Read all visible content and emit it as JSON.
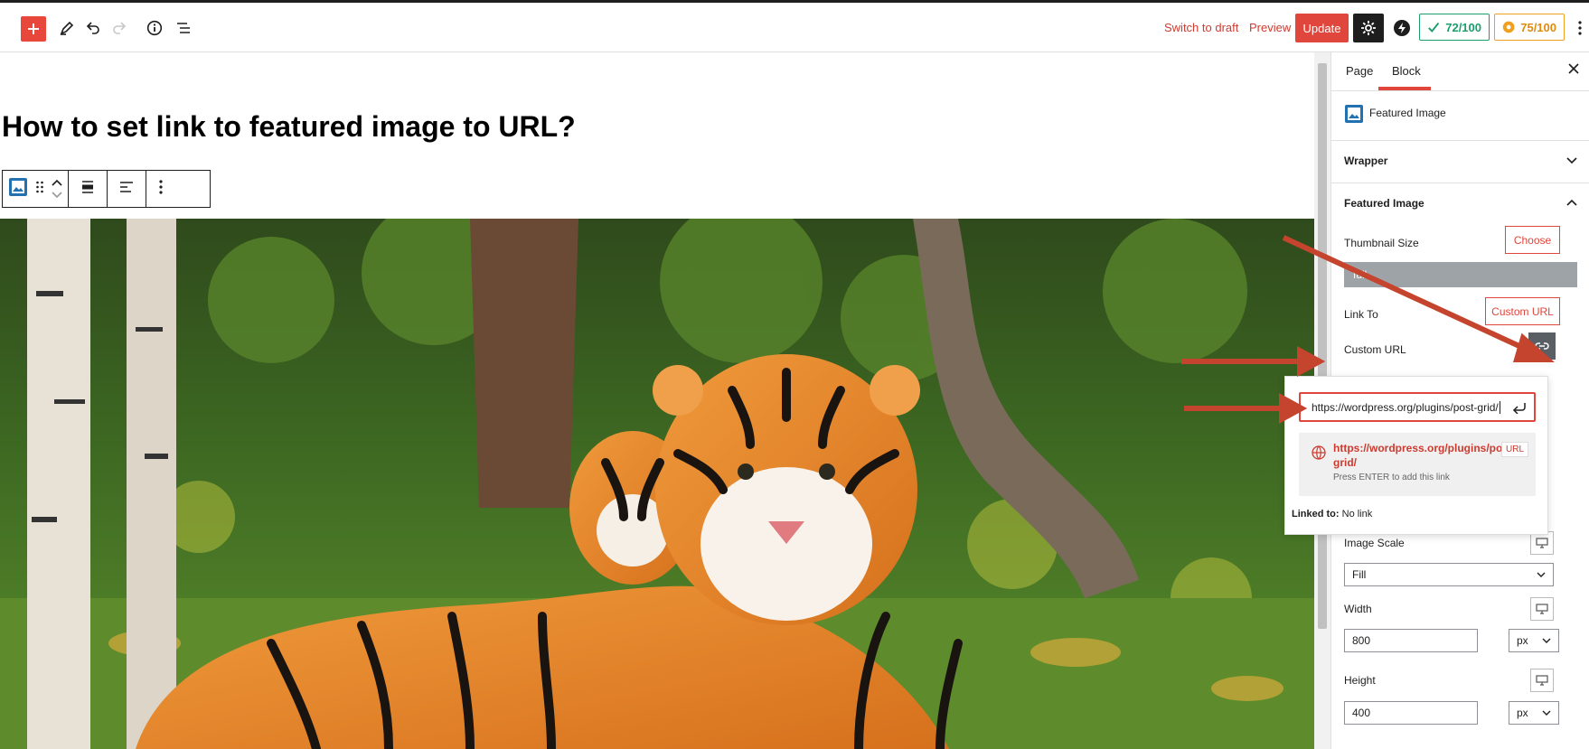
{
  "colors": {
    "accent": "#e0463b",
    "accent_text": "#cc3b30",
    "seo_green": "#1b9e6b",
    "seo_orange": "#f0a020",
    "dark": "#1e1e1e"
  },
  "topbar": {
    "switch_to_draft": "Switch to draft",
    "preview": "Preview",
    "update": "Update",
    "score_seo": "72/100",
    "score_readability": "75/100"
  },
  "editor": {
    "title": "How to set link to featured image to URL?",
    "image_alt": "Tiger and cub lying in grass"
  },
  "sidebar": {
    "tab_page": "Page",
    "tab_block": "Block",
    "block_name": "Featured Image",
    "panel_wrapper": "Wrapper",
    "panel_featured": "Featured Image",
    "thumbnail_size_label": "Thumbnail Size",
    "choose_label": "Choose",
    "thumbnail_value": "full",
    "link_to_label": "Link To",
    "link_to_value": "Custom URL",
    "custom_url_label": "Custom URL",
    "image_scale_label": "Image Scale",
    "image_scale_value": "Fill",
    "width_label": "Width",
    "width_value": "800",
    "width_unit": "px",
    "height_label": "Height",
    "height_value": "400",
    "height_unit": "px"
  },
  "link_popover": {
    "input_value": "https://wordpress.org/plugins/post-grid/",
    "suggestion_line1": "https://wordpress.org/plugins/post-",
    "suggestion_line2": "grid/",
    "suggestion_badge": "URL",
    "suggestion_hint": "Press ENTER to add this link",
    "linked_to_label": "Linked to:",
    "linked_to_value": "No link"
  }
}
